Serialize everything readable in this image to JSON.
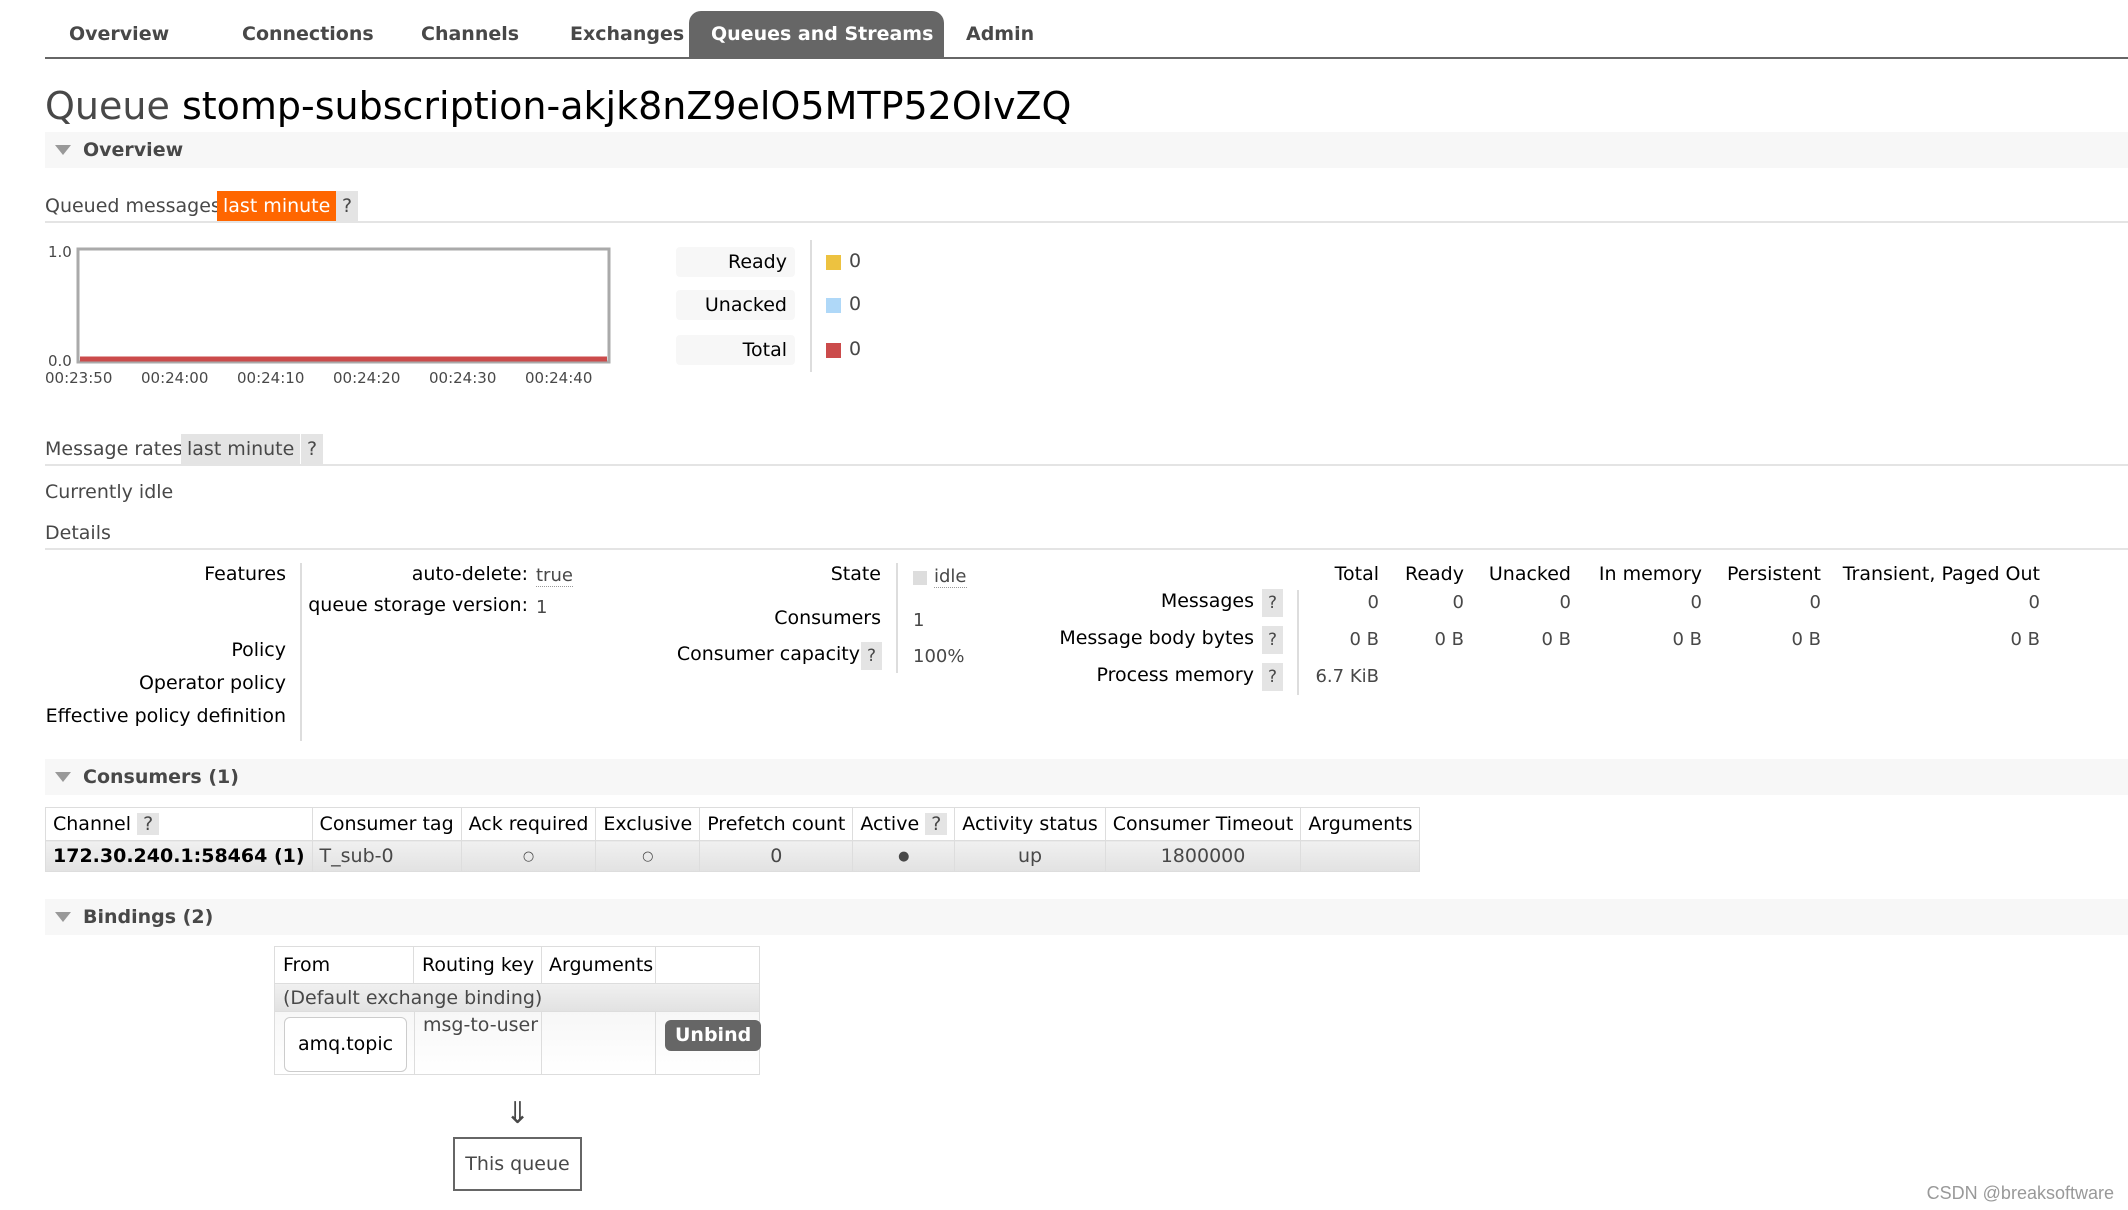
{
  "tabs": [
    {
      "label": "Overview",
      "active": false
    },
    {
      "label": "Connections",
      "active": false
    },
    {
      "label": "Channels",
      "active": false
    },
    {
      "label": "Exchanges",
      "active": false
    },
    {
      "label": "Queues and Streams",
      "active": true
    },
    {
      "label": "Admin",
      "active": false
    }
  ],
  "title": {
    "prefix": "Queue",
    "name": "stomp-subscription-akjk8nZ9elO5MTP52OIvZQ"
  },
  "overview": {
    "section_label": "Overview",
    "queued_messages": {
      "label": "Queued messages",
      "range": "last minute",
      "help": "?"
    },
    "legend": [
      {
        "label": "Ready",
        "value": "0",
        "color": "#edc240"
      },
      {
        "label": "Unacked",
        "value": "0",
        "color": "#afd8f8"
      },
      {
        "label": "Total",
        "value": "0",
        "color": "#cb4b4b"
      }
    ],
    "message_rates": {
      "label": "Message rates",
      "range": "last minute",
      "help": "?"
    },
    "idle_text": "Currently idle",
    "details_label": "Details"
  },
  "chart_data": {
    "type": "line",
    "title": "Queued messages",
    "x": [
      "00:23:50",
      "00:24:00",
      "00:24:10",
      "00:24:20",
      "00:24:30",
      "00:24:40"
    ],
    "series": [
      {
        "name": "Ready",
        "color": "#edc240",
        "values": [
          0,
          0,
          0,
          0,
          0,
          0
        ]
      },
      {
        "name": "Unacked",
        "color": "#afd8f8",
        "values": [
          0,
          0,
          0,
          0,
          0,
          0
        ]
      },
      {
        "name": "Total",
        "color": "#cb4b4b",
        "values": [
          0,
          0,
          0,
          0,
          0,
          0
        ]
      }
    ],
    "yticks": [
      "1.0",
      "0.0"
    ],
    "ylim": [
      0,
      1
    ],
    "xlabel": "",
    "ylabel": "",
    "grid": false
  },
  "details": {
    "features_label": "Features",
    "features": [
      {
        "key": "auto-delete:",
        "value": "true"
      },
      {
        "key": "queue storage version:",
        "value": "1"
      }
    ],
    "policy_label": "Policy",
    "operator_policy_label": "Operator policy",
    "effective_policy_label": "Effective policy definition",
    "state_label": "State",
    "state_value": "idle",
    "consumers_label": "Consumers",
    "consumers_value": "1",
    "consumer_capacity_label": "Consumer capacity",
    "consumer_capacity_value": "100%",
    "help": "?",
    "metrics_columns": [
      "Total",
      "Ready",
      "Unacked",
      "In memory",
      "Persistent",
      "Transient, Paged Out"
    ],
    "metrics_rows": [
      {
        "label": "Messages",
        "values": [
          "0",
          "0",
          "0",
          "0",
          "0",
          "0"
        ]
      },
      {
        "label": "Message body bytes",
        "values": [
          "0 B",
          "0 B",
          "0 B",
          "0 B",
          "0 B",
          "0 B"
        ]
      },
      {
        "label": "Process memory",
        "values": [
          "6.7 KiB"
        ]
      }
    ]
  },
  "consumers": {
    "section_label": "Consumers (1)",
    "columns": [
      "Channel",
      "Consumer tag",
      "Ack required",
      "Exclusive",
      "Prefetch count",
      "Active",
      "Activity status",
      "Consumer Timeout",
      "Arguments"
    ],
    "help": "?",
    "rows": [
      {
        "channel": "172.30.240.1:58464 (1)",
        "consumer_tag": "T_sub-0",
        "ack_required": "○",
        "exclusive": "○",
        "prefetch_count": "0",
        "active": "●",
        "activity_status": "up",
        "consumer_timeout": "1800000",
        "arguments": ""
      }
    ]
  },
  "bindings": {
    "section_label": "Bindings (2)",
    "columns": [
      "From",
      "Routing key",
      "Arguments"
    ],
    "default_binding": "(Default exchange binding)",
    "rows": [
      {
        "from": "amq.topic",
        "routing_key": "msg-to-user",
        "arguments": "",
        "action": "Unbind"
      }
    ],
    "arrow": "⇓",
    "this_queue": "This queue"
  },
  "watermark": "CSDN @breaksoftware"
}
